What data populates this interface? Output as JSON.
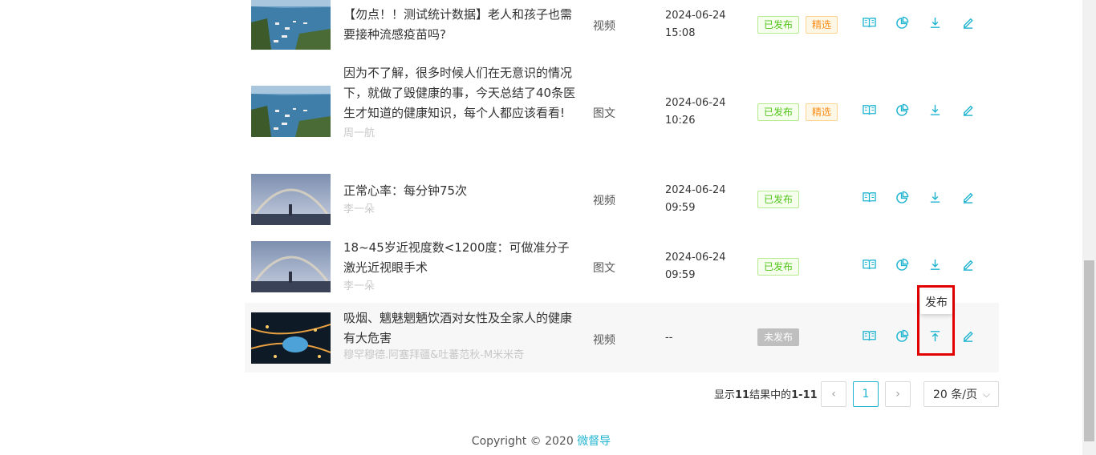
{
  "rows": [
    {
      "title": "【勿点！！测试统计数据】老人和孩子也需要接种流感疫苗吗?",
      "author": "",
      "type": "视频",
      "date": "2024-06-24",
      "time": "15:08",
      "tags": [
        "已发布",
        "精选"
      ],
      "thumb": "harbor"
    },
    {
      "title": "因为不了解，很多时候人们在无意识的情况下，就做了毁健康的事，今天总结了40条医生才知道的健康知识，每个人都应该看看!",
      "author": "周一航",
      "type": "图文",
      "date": "2024-06-24",
      "time": "10:26",
      "tags": [
        "已发布",
        "精选"
      ],
      "thumb": "harbor"
    },
    {
      "title": "正常心率：每分钟75次",
      "author": "李一朵",
      "type": "视频",
      "date": "2024-06-24",
      "time": "09:59",
      "tags": [
        "已发布"
      ],
      "thumb": "rainbow"
    },
    {
      "title": "18~45岁近视度数<1200度：可做准分子激光近视眼手术",
      "author": "李一朵",
      "type": "图文",
      "date": "2024-06-24",
      "time": "09:59",
      "tags": [
        "已发布"
      ],
      "thumb": "rainbow"
    },
    {
      "title": "吸烟、魑魅魍魉饮酒对女性及全家人的健康有大危害",
      "author": "穆罕穆德.阿塞拜疆&吐蕃范秋-M米米奇",
      "type": "视频",
      "date": "--",
      "time": "",
      "tags": [
        "未发布"
      ],
      "thumb": "city"
    }
  ],
  "actions": {
    "preview_icon": "book-icon",
    "stats_icon": "pie-chart-icon",
    "download_icon": "download-icon",
    "publish_icon": "publish-upload-icon",
    "edit_icon": "edit-pencil-icon"
  },
  "tooltip": {
    "label": "发布"
  },
  "pagination": {
    "info_prefix": "显示",
    "info_total": "11",
    "info_mid": "结果中的",
    "info_range": "1-11",
    "prev": "‹",
    "current_page": "1",
    "next": "›",
    "page_size": "20 条/页"
  },
  "footer": {
    "copyright": "Copyright © 2020 ",
    "brand": "微督导"
  },
  "colors": {
    "accent": "#1fb4d0",
    "published": "#52c41a",
    "featured": "#fa8c16",
    "unpublished": "#bfbfbf",
    "highlight": "#e30000"
  }
}
